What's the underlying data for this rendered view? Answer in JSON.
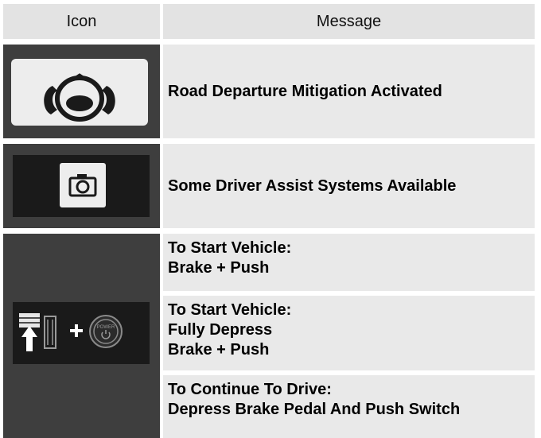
{
  "header": {
    "icon_label": "Icon",
    "message_label": "Message"
  },
  "rows": [
    {
      "icon": "steering-wheel-icon",
      "message_lines": [
        "Road Departure Mitigation Activated"
      ]
    },
    {
      "icon": "camera-icon",
      "message_lines": [
        "Some Driver Assist Systems Available"
      ]
    },
    {
      "icon": "brake-power-button-icon",
      "messages": [
        {
          "lines": [
            "To Start Vehicle:",
            "Brake + Push"
          ]
        },
        {
          "lines": [
            "To Start Vehicle:",
            "Fully Depress",
            "Brake + Push"
          ]
        },
        {
          "lines": [
            "To Continue To Drive:",
            "Depress Brake Pedal And Push Switch"
          ]
        }
      ],
      "power_label": "POWER"
    }
  ],
  "colors": {
    "header_bg": "#e3e3e3",
    "icon_cell_bg": "#3e3e3e",
    "message_cell_bg": "#e9e9e9",
    "icon_panel_dark": "#1a1a1a"
  }
}
